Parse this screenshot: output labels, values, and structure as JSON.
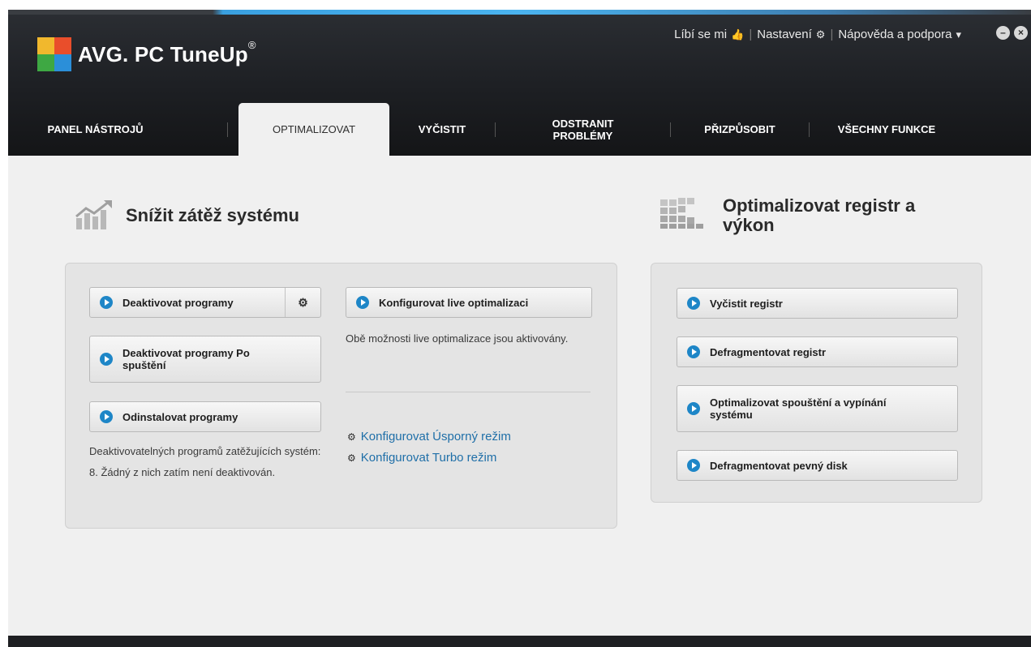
{
  "app": {
    "logo_text": "AVG. PC TuneUp",
    "logo_mark": "®"
  },
  "topbar": {
    "like": "Líbí se mi",
    "settings": "Nastavení",
    "help": "Nápověda a podpora",
    "like_icon": "thumbs-up-icon",
    "settings_icon": "gear-icon",
    "help_icon": "chevron-down-icon"
  },
  "window_controls": {
    "minimize": "–",
    "close": "×"
  },
  "nav": {
    "tabs": [
      {
        "label": "PANEL NÁSTROJŮ",
        "active": false
      },
      {
        "label": "OPTIMALIZOVAT",
        "active": true
      },
      {
        "label": "VYČISTIT",
        "active": false
      },
      {
        "label": "ODSTRANIT PROBLÉMY",
        "active": false
      },
      {
        "label": "PŘIZPŮSOBIT",
        "active": false
      },
      {
        "label": "VŠECHNY FUNKCE",
        "active": false
      }
    ]
  },
  "left_section": {
    "title": "Snížit zátěž systému",
    "buttons": {
      "deactivate": "Deaktivovat programy",
      "deactivate_startup": "Deaktivovat programy Po spuštění",
      "uninstall": "Odinstalovat programy",
      "live": "Konfigurovat live optimalizaci"
    },
    "status_text": "Deaktivovatelných programů zatěžujících systém: 8. Žádný z nich zatím není deaktivován.",
    "live_status_text": "Obě možnosti live optimalizace jsou aktivovány.",
    "links": {
      "economy": "Konfigurovat Úsporný režim",
      "turbo": "Konfigurovat Turbo režim"
    }
  },
  "right_section": {
    "title": "Optimalizovat registr a výkon",
    "buttons": {
      "clean_registry": "Vyčistit registr",
      "defrag_registry": "Defragmentovat registr",
      "optimize_startup": "Optimalizovat spouštění a vypínání systému",
      "defrag_disk": "Defragmentovat pevný disk"
    }
  },
  "colors": {
    "accent_blue": "#1e86c7",
    "link_blue": "#1f6fa8",
    "header_dark": "#1d1f23"
  }
}
